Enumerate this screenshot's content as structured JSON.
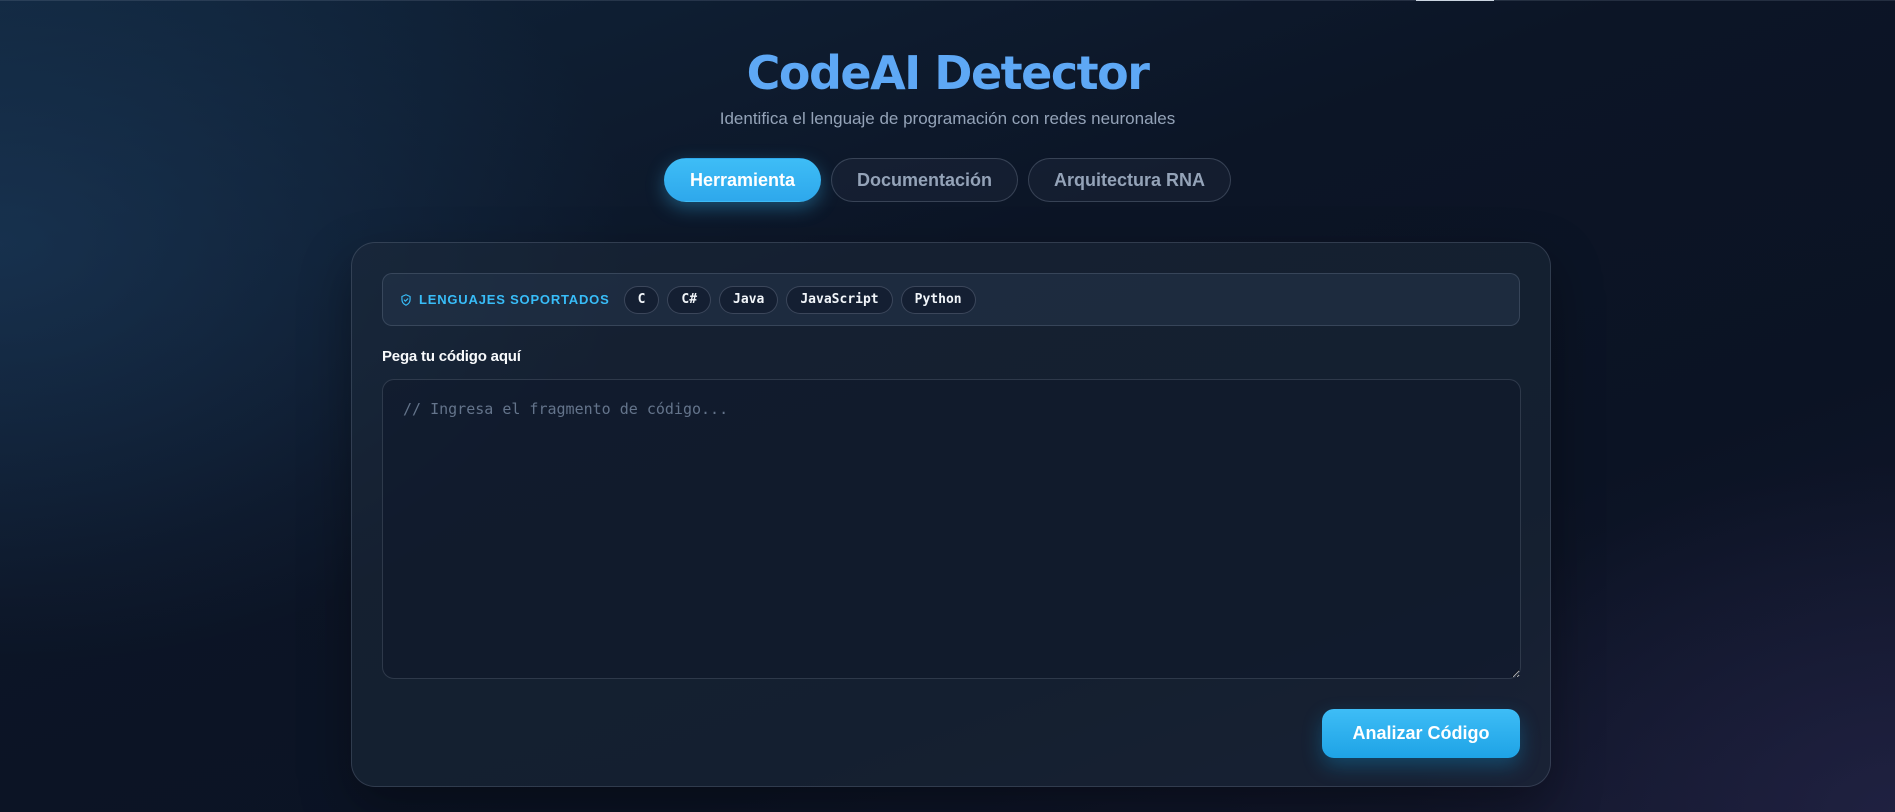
{
  "header": {
    "title": "CodeAI Detector",
    "subtitle": "Identifica el lenguaje de programación con redes neuronales"
  },
  "tabs": [
    {
      "label": "Herramienta",
      "active": true
    },
    {
      "label": "Documentación",
      "active": false
    },
    {
      "label": "Arquitectura RNA",
      "active": false
    }
  ],
  "languages": {
    "label": "LENGUAJES SOPORTADOS",
    "icon": "shield-check-icon",
    "items": [
      "C",
      "C#",
      "Java",
      "JavaScript",
      "Python"
    ]
  },
  "editor": {
    "label": "Pega tu código aquí",
    "value": "",
    "placeholder": "// Ingresa el fragmento de código..."
  },
  "actions": {
    "analyze_label": "Analizar Código"
  },
  "colors": {
    "accent": "#38bdf8",
    "title": "#5ea8f5",
    "background": "#0c1526"
  }
}
